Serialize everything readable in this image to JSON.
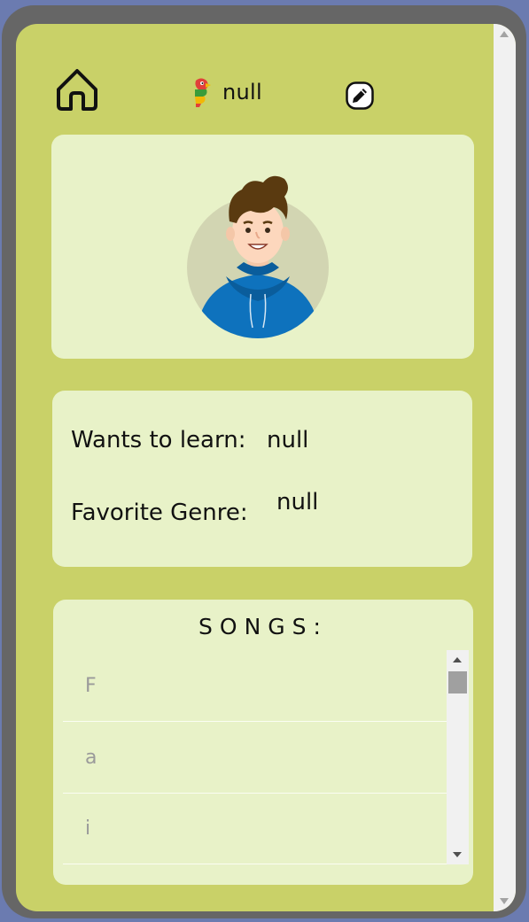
{
  "header": {
    "username": "null"
  },
  "profile": {
    "wants_to_learn_label": "Wants to learn:",
    "wants_to_learn_value": "null",
    "favorite_genre_label": "Favorite Genre:",
    "favorite_genre_value": "null"
  },
  "songs": {
    "title": "SONGS:",
    "items": [
      "F",
      "a",
      "i"
    ]
  },
  "colors": {
    "background": "#c9d168",
    "card": "#e8f2c8",
    "frame": "#666666",
    "page": "#6b7bb0"
  },
  "icons": {
    "home": "home-icon",
    "logo": "parrot-logo-icon",
    "edit": "edit-pencil-icon",
    "avatar": "user-avatar"
  }
}
